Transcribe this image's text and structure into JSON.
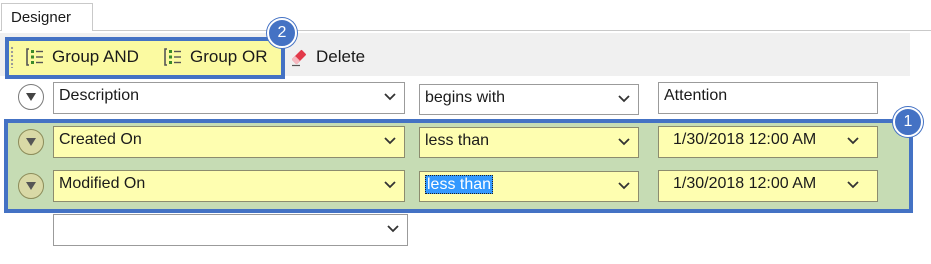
{
  "tab": {
    "label": "Designer"
  },
  "toolbar": {
    "group_and": "Group AND",
    "group_or": "Group OR",
    "delete": "Delete"
  },
  "callouts": {
    "rows": "1",
    "toolbar": "2"
  },
  "rows": [
    {
      "field": "Description",
      "operator": "begins with",
      "value": "Attention",
      "highlighted": false
    },
    {
      "field": "Created On",
      "operator": "less than",
      "value": "1/30/2018 12:00 AM",
      "highlighted": true
    },
    {
      "field": "Modified On",
      "operator": "less than",
      "value": "1/30/2018 12:00 AM",
      "highlighted": true
    },
    {
      "field": "",
      "operator": null,
      "value": null,
      "highlighted": false
    }
  ],
  "colors": {
    "callout_blue": "#4472c4",
    "toolbar_highlight": "#fbfaa1",
    "rows_highlight": "#c6dcb4",
    "field_yellow": "#fefeb0",
    "selection": "#3399ff"
  },
  "icons": [
    "group-and-icon",
    "group-or-icon",
    "delete-eraser-icon",
    "row-menu-icon",
    "chevron-down-icon"
  ]
}
